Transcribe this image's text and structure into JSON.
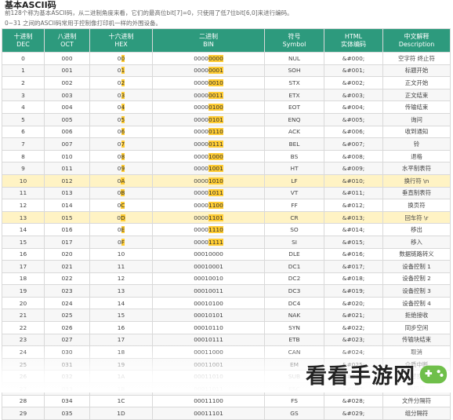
{
  "header": {
    "title": "基本ASCII码",
    "desc1": "前128个称为基本ASCII码，从二进制角度来看，它们的最高位bit[7]=0，只使用了低7位bit[6,0]来进行编码。",
    "desc2": "0~31 之间的ASCII码常用于控制像打印机一样的外围设备。"
  },
  "table": {
    "headers": [
      [
        "十进制",
        "DEC"
      ],
      [
        "八进制",
        "OCT"
      ],
      [
        "十六进制",
        "HEX"
      ],
      [
        "二进制",
        "BIN"
      ],
      [
        "符号",
        "Symbol"
      ],
      [
        "HTML",
        "实体编码"
      ],
      [
        "中文解释",
        "Description"
      ]
    ],
    "rows": [
      {
        "dec": "0",
        "oct": "000",
        "hex": "0",
        "hexm": "0",
        "bin": "0000",
        "binm": "0000",
        "sym": "NUL",
        "html": "&#000;",
        "desc": "空字符 终止符"
      },
      {
        "dec": "1",
        "oct": "001",
        "hex": "0",
        "hexm": "1",
        "bin": "0000",
        "binm": "0001",
        "sym": "SOH",
        "html": "&#001;",
        "desc": "标题开始"
      },
      {
        "dec": "2",
        "oct": "002",
        "hex": "0",
        "hexm": "2",
        "bin": "0000",
        "binm": "0010",
        "sym": "STX",
        "html": "&#002;",
        "desc": "正文开始"
      },
      {
        "dec": "3",
        "oct": "003",
        "hex": "0",
        "hexm": "3",
        "bin": "0000",
        "binm": "0011",
        "sym": "ETX",
        "html": "&#003;",
        "desc": "正文结束"
      },
      {
        "dec": "4",
        "oct": "004",
        "hex": "0",
        "hexm": "4",
        "bin": "0000",
        "binm": "0100",
        "sym": "EOT",
        "html": "&#004;",
        "desc": "传输结束"
      },
      {
        "dec": "5",
        "oct": "005",
        "hex": "0",
        "hexm": "5",
        "bin": "0000",
        "binm": "0101",
        "sym": "ENQ",
        "html": "&#005;",
        "desc": "询问"
      },
      {
        "dec": "6",
        "oct": "006",
        "hex": "0",
        "hexm": "6",
        "bin": "0000",
        "binm": "0110",
        "sym": "ACK",
        "html": "&#006;",
        "desc": "收到通知"
      },
      {
        "dec": "7",
        "oct": "007",
        "hex": "0",
        "hexm": "7",
        "bin": "0000",
        "binm": "0111",
        "sym": "BEL",
        "html": "&#007;",
        "desc": "铃"
      },
      {
        "dec": "8",
        "oct": "010",
        "hex": "0",
        "hexm": "8",
        "bin": "0000",
        "binm": "1000",
        "sym": "BS",
        "html": "&#008;",
        "desc": "退格"
      },
      {
        "dec": "9",
        "oct": "011",
        "hex": "0",
        "hexm": "9",
        "bin": "0000",
        "binm": "1001",
        "sym": "HT",
        "html": "&#009;",
        "desc": "水平制表符"
      },
      {
        "dec": "10",
        "oct": "012",
        "hex": "0",
        "hexm": "A",
        "bin": "0000",
        "binm": "1010",
        "sym": "LF",
        "html": "&#010;",
        "desc": "换行符 \\n",
        "hl": true
      },
      {
        "dec": "11",
        "oct": "013",
        "hex": "0",
        "hexm": "B",
        "bin": "0000",
        "binm": "1011",
        "sym": "VT",
        "html": "&#011;",
        "desc": "垂直制表符"
      },
      {
        "dec": "12",
        "oct": "014",
        "hex": "0",
        "hexm": "C",
        "bin": "0000",
        "binm": "1100",
        "sym": "FF",
        "html": "&#012;",
        "desc": "换页符"
      },
      {
        "dec": "13",
        "oct": "015",
        "hex": "0",
        "hexm": "D",
        "bin": "0000",
        "binm": "1101",
        "sym": "CR",
        "html": "&#013;",
        "desc": "回车符 \\r",
        "hl": true
      },
      {
        "dec": "14",
        "oct": "016",
        "hex": "0",
        "hexm": "E",
        "bin": "0000",
        "binm": "1110",
        "sym": "SO",
        "html": "&#014;",
        "desc": "移出"
      },
      {
        "dec": "15",
        "oct": "017",
        "hex": "0",
        "hexm": "F",
        "bin": "0000",
        "binm": "1111",
        "sym": "SI",
        "html": "&#015;",
        "desc": "移入"
      },
      {
        "dec": "16",
        "oct": "020",
        "hex": "10",
        "hexm": "",
        "bin": "00010000",
        "binm": "",
        "sym": "DLE",
        "html": "&#016;",
        "desc": "数据链路转义"
      },
      {
        "dec": "17",
        "oct": "021",
        "hex": "11",
        "hexm": "",
        "bin": "00010001",
        "binm": "",
        "sym": "DC1",
        "html": "&#017;",
        "desc": "设备控制 1"
      },
      {
        "dec": "18",
        "oct": "022",
        "hex": "12",
        "hexm": "",
        "bin": "00010010",
        "binm": "",
        "sym": "DC2",
        "html": "&#018;",
        "desc": "设备控制 2"
      },
      {
        "dec": "19",
        "oct": "023",
        "hex": "13",
        "hexm": "",
        "bin": "00010011",
        "binm": "",
        "sym": "DC3",
        "html": "&#019;",
        "desc": "设备控制 3"
      },
      {
        "dec": "20",
        "oct": "024",
        "hex": "14",
        "hexm": "",
        "bin": "00010100",
        "binm": "",
        "sym": "DC4",
        "html": "&#020;",
        "desc": "设备控制 4"
      },
      {
        "dec": "21",
        "oct": "025",
        "hex": "15",
        "hexm": "",
        "bin": "00010101",
        "binm": "",
        "sym": "NAK",
        "html": "&#021;",
        "desc": "拒绝接收"
      },
      {
        "dec": "22",
        "oct": "026",
        "hex": "16",
        "hexm": "",
        "bin": "00010110",
        "binm": "",
        "sym": "SYN",
        "html": "&#022;",
        "desc": "同步空闲"
      },
      {
        "dec": "23",
        "oct": "027",
        "hex": "17",
        "hexm": "",
        "bin": "00010111",
        "binm": "",
        "sym": "ETB",
        "html": "&#023;",
        "desc": "传输块结束"
      },
      {
        "dec": "24",
        "oct": "030",
        "hex": "18",
        "hexm": "",
        "bin": "00011000",
        "binm": "",
        "sym": "CAN",
        "html": "&#024;",
        "desc": "取消"
      },
      {
        "dec": "25",
        "oct": "031",
        "hex": "19",
        "hexm": "",
        "bin": "00011001",
        "binm": "",
        "sym": "EM",
        "html": "&#025;",
        "desc": "介质中断"
      },
      {
        "dec": "26",
        "oct": "032",
        "hex": "1A",
        "hexm": "",
        "bin": "00011010",
        "binm": "",
        "sym": "SUB",
        "html": "&#026;",
        "desc": "替换"
      },
      {
        "dec": "27",
        "oct": "033",
        "hex": "1B",
        "hexm": "",
        "bin": "00011011",
        "binm": "",
        "sym": "ESC",
        "html": "&#027;",
        "desc": "换码符"
      },
      {
        "dec": "28",
        "oct": "034",
        "hex": "1C",
        "hexm": "",
        "bin": "00011100",
        "binm": "",
        "sym": "FS",
        "html": "&#028;",
        "desc": "文件分隔符"
      },
      {
        "dec": "29",
        "oct": "035",
        "hex": "1D",
        "hexm": "",
        "bin": "00011101",
        "binm": "",
        "sym": "GS",
        "html": "&#029;",
        "desc": "组分隔符"
      }
    ]
  },
  "watermark": {
    "text": "看看手游网"
  },
  "colors": {
    "header_bg": "#2d9a7d",
    "highlight_row": "#fff3c4",
    "highlight_mark": "#ffcc33"
  }
}
